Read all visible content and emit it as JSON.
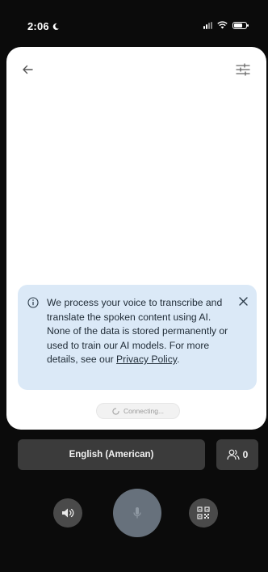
{
  "status_bar": {
    "time": "2:06"
  },
  "notice": {
    "text": "We process your voice to transcribe and translate the spoken content using AI. None of the data is stored permanently or used to train our AI models. For more details, see our",
    "link_label": "Privacy Policy",
    "link_suffix": "."
  },
  "connection": {
    "status": "Connecting..."
  },
  "controls": {
    "language_label": "English (American)",
    "participant_count": "0"
  },
  "colors": {
    "background": "#0b0b0b",
    "card": "#ffffff",
    "notice_bg": "#dbe9f7",
    "button_bg": "#3b3b3b",
    "mic_bg": "#67717c"
  },
  "icons": {
    "back": "arrow-left-icon",
    "settings": "sliders-icon",
    "info": "info-icon",
    "close": "close-icon",
    "spinner": "spinner-icon",
    "participants": "people-icon",
    "speaker": "speaker-icon",
    "mic": "mic-icon",
    "qr": "qr-code-icon"
  }
}
